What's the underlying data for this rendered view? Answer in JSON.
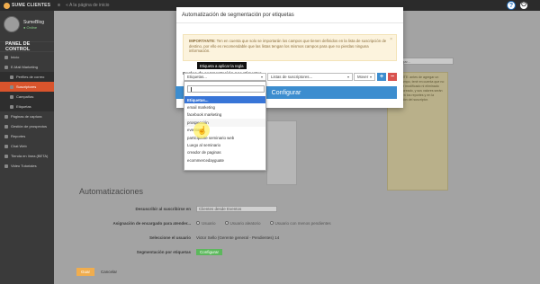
{
  "topbar": {
    "brand": "SUME CLIENTES",
    "crumb": "« A la página de inicio",
    "help_glyph": "?",
    "power_glyph": "⏻"
  },
  "sidebar": {
    "user_name": "SumeBlog",
    "user_status": "● Online",
    "panel_title": "PANEL DE CONTROL",
    "items": [
      {
        "label": "Inicio"
      },
      {
        "label": "E-Mail Marketing"
      },
      {
        "label": "Perfiles de correo"
      },
      {
        "label": "Suscriptores"
      },
      {
        "label": "Campañas"
      },
      {
        "label": "Etiquetas"
      },
      {
        "label": "Páginas de captura"
      },
      {
        "label": "Gestión de prospectos"
      },
      {
        "label": "Reportes"
      },
      {
        "label": "Chat Web"
      },
      {
        "label": "Tienda en línea (BETA)"
      },
      {
        "label": "Video Tutoriales"
      }
    ],
    "active_index": 3
  },
  "main": {
    "side_input_placeholder": "gar...",
    "info_text": "PORTANTE: antes de agregar un nuevo campo, tené en cuenta que no podrá ser modificado ni eliminado una vez creado, y sus valores serán visibles en los reportes y en la información del suscriptor.",
    "automations_title": "Automatizaciones",
    "rows": {
      "subscribe_label": "Desuscribir al suscribirse en",
      "subscribe_value": "Clientes desde Eventos",
      "assign_label": "Asignación de encargado para atender...",
      "assign_options": [
        "Usuario",
        "Usuario aleatorio",
        "Usuario con menos pendientes"
      ],
      "user_label": "Seleccione el usuario",
      "user_value": "Victor Sello (Gerente general - Pendientes) 14",
      "tags_label": "Segmentación por etiquetas",
      "tags_button": "Configurar"
    },
    "save_button": "Guar",
    "cancel_link": "Cancelar"
  },
  "modal": {
    "title": "Automatización de segmentación por etiquetas",
    "warning_strong": "IMPORTANTE:",
    "warning_text": "Ten en cuenta que solo se importarán los campos que tienen definidos en la lista de suscripción de destino, por ello es recomendable que las listas tengan los mismos campos para que no pierdas ninguna información.",
    "close_glyph": "×",
    "rules_label": "Reglas de segmentación por etiquetas",
    "tooltip": "Etiqueta a aplicar la regla",
    "tag_select": "Etiquetas...",
    "list_select": "Listas de suscriptores...",
    "action_select": "Mover",
    "add_glyph": "+",
    "remove_glyph": "−",
    "configure_button": "Configurar"
  },
  "dropdown": {
    "options": [
      "Etiquetas...",
      "email marketing",
      "facebook marketing",
      "prospección",
      "eventos",
      "participante seminario web",
      "Luego al seminario",
      "creador de paginas",
      "ecommercedayguate"
    ],
    "highlighted_index": 0
  },
  "colors": {
    "accent": "#3c8dcf",
    "active_nav": "#d9542c",
    "danger": "#d9534f",
    "success": "#5cb85c"
  }
}
